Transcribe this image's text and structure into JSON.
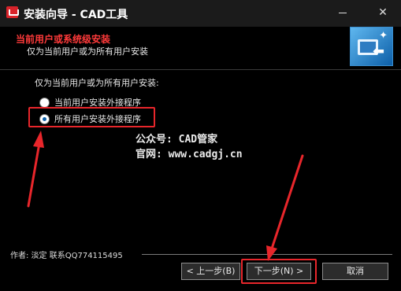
{
  "window": {
    "title": "安装向导 - CAD工具",
    "minimize_icon": "minimize-icon",
    "close_icon": "close-icon",
    "close_glyph": "✕"
  },
  "header": {
    "title": "当前用户或系统级安装",
    "subtitle": "仅为当前用户或为所有用户安装",
    "image_icon": "install-computer-icon"
  },
  "body": {
    "prompt": "仅为当前用户或为所有用户安装:",
    "options": [
      {
        "label": "当前用户安装外接程序",
        "checked": false
      },
      {
        "label": "所有用户安装外接程序",
        "checked": true
      }
    ],
    "watermark_line1": "公众号: CAD管家",
    "watermark_line2": "官网: www.cadgj.cn"
  },
  "footer": {
    "author": "作者: 淡定   联系QQ774115495",
    "back_label": "< 上一步(B)",
    "next_label": "下一步(N) >",
    "cancel_label": "取消"
  },
  "colors": {
    "annotation": "#e8262b",
    "header_title": "#ff3a3a"
  }
}
